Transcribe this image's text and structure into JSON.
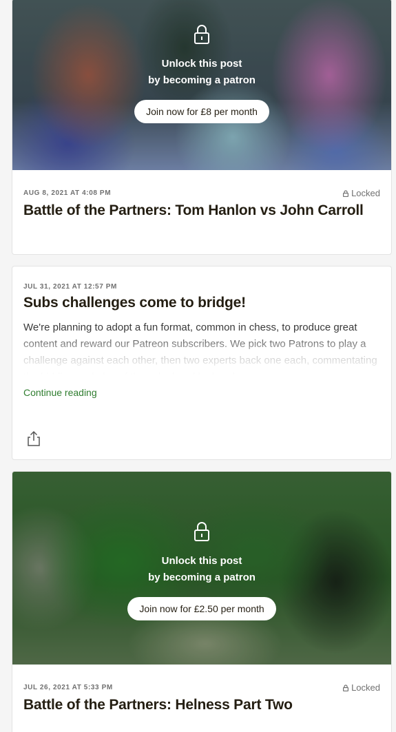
{
  "posts": [
    {
      "locked": true,
      "unlock_line1": "Unlock this post",
      "unlock_line2": "by becoming a patron",
      "join_label": "Join now for £8 per month",
      "date": "AUG 8, 2021 AT 4:08 PM",
      "locked_label": "Locked",
      "title": "Battle of the Partners: Tom Hanlon vs John Carroll"
    },
    {
      "locked": false,
      "date": "JUL 31, 2021 AT 12:57 PM",
      "title": "Subs challenges come to bridge!",
      "excerpt": "We're planning to adopt a fun format, common in chess, to produce great content and reward our Patreon subscribers.  We pick two Patrons to play a challenge against each other, then two experts back one each, commentating the bidding and play of the subs hand by hand.",
      "continue_label": "Continue reading",
      "share_icon": "share-icon"
    },
    {
      "locked": true,
      "unlock_line1": "Unlock this post",
      "unlock_line2": "by becoming a patron",
      "join_label": "Join now for £2.50 per month",
      "date": "JUL 26, 2021 AT 5:33 PM",
      "locked_label": "Locked",
      "title": "Battle of the Partners: Helness Part Two"
    }
  ],
  "colors": {
    "link_green": "#2f7d2f",
    "meta_gray": "#707070",
    "title_dark": "#241e12"
  }
}
